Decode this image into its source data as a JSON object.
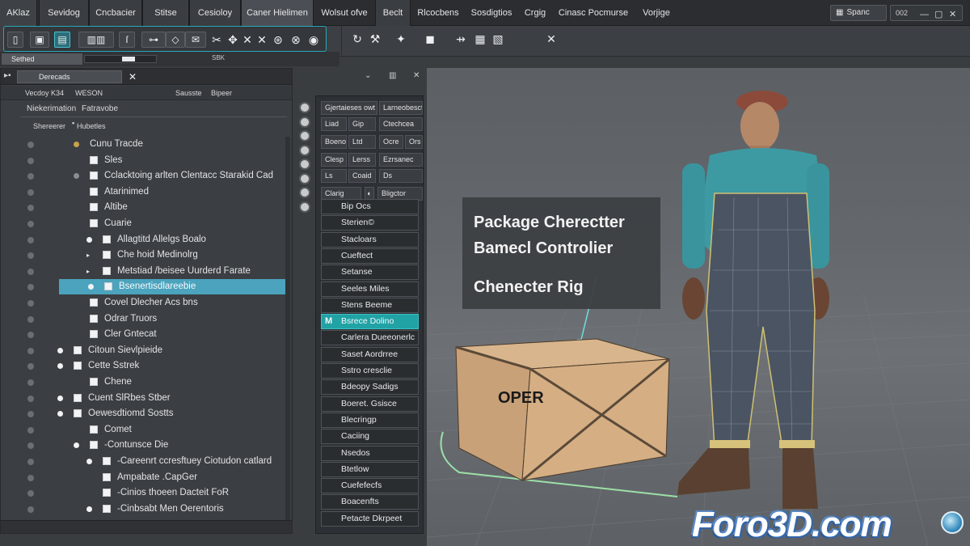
{
  "menubar": {
    "app_badge": "AKlaz",
    "items": [
      "Sevidog",
      "Cncbacier",
      "Stitse",
      "Cesioloy",
      "Caner Hielimen",
      "Wolsut ofve",
      "Beclt",
      "Rlcocbens",
      "Sosdigtios",
      "Crgig",
      "Cinasc Pocmurse",
      "Vorjige"
    ],
    "search_label": "Spanc",
    "system_label": "002"
  },
  "toolbar": {
    "group_icons": [
      "file-icon",
      "image-icon",
      "page-icon",
      "film-icon",
      "curve-icon",
      "node-icon",
      "mail-icon",
      "scissors-icon",
      "transform-icon",
      "close-icon",
      "globe-icon",
      "settings-icon"
    ],
    "right_icons": [
      "refresh-icon",
      "tool-icon",
      "pin-icon",
      "square-icon",
      "link-icon",
      "layout-icon",
      "close-icon"
    ]
  },
  "subbar": {
    "tab_label": "Sethed",
    "tag": "SBK"
  },
  "outliner": {
    "tab_label": "Derecads",
    "columns": {
      "left": "Vecdoy K34",
      "mid": "WESON",
      "right": "Sausste",
      "far": "Bipeer"
    },
    "filter_a": "Niekerimation",
    "filter_b": "Fatravobe",
    "filter2_a": "Shereerer",
    "filter2_b": "Hubetles",
    "rows": [
      {
        "label": "Cunu Tracde",
        "indent": 1,
        "marker": "gold"
      },
      {
        "label": "Sles",
        "indent": 2,
        "marker": "checkbox"
      },
      {
        "label": "Cclacktoing arlten Clentacc Starakid Cad",
        "indent": 2,
        "marker": "grey-checkbox"
      },
      {
        "label": "Atarinimed",
        "indent": 2,
        "marker": "checkbox"
      },
      {
        "label": "Altibe",
        "indent": 2,
        "marker": "checkbox"
      },
      {
        "label": "Cuarie",
        "indent": 2,
        "marker": "checkbox"
      },
      {
        "label": "Allagtitd Allelgs Boalo",
        "indent": 3,
        "marker": "dot-checkbox"
      },
      {
        "label": "Che hoid Medinolrg",
        "indent": 3,
        "marker": "arrow-checkbox"
      },
      {
        "label": "Metstiad /beisee Uurderd Farate",
        "indent": 3,
        "marker": "arrow-checkbox"
      },
      {
        "label": "Bsenertisdlareebie",
        "indent": 3,
        "marker": "dot-checkbox",
        "selected": true
      },
      {
        "label": "Covel Dlecher Acs bns",
        "indent": 2,
        "marker": "checkbox"
      },
      {
        "label": "Odrar Truors",
        "indent": 2,
        "marker": "checkbox"
      },
      {
        "label": "Cler Gntecat",
        "indent": 2,
        "marker": "checkbox"
      },
      {
        "label": "Citoun Sievlpieide",
        "indent": 1,
        "marker": "dot-checkbox"
      },
      {
        "label": "Cette Sstrek",
        "indent": 1,
        "marker": "dot-checkbox"
      },
      {
        "label": "Chene",
        "indent": 2,
        "marker": "checkbox"
      },
      {
        "label": "Cuent SlRbes Stber",
        "indent": 1,
        "marker": "dot-checkbox"
      },
      {
        "label": "Oewesdtiomd Sostts",
        "indent": 1,
        "marker": "dot-checkbox"
      },
      {
        "label": "Comet",
        "indent": 2,
        "marker": "checkbox"
      },
      {
        "label": "-Contunsce Die",
        "indent": 2,
        "marker": "dot-checkbox"
      },
      {
        "label": "-Careenrt ccresftuey Ciotudon catlard",
        "indent": 3,
        "marker": "dot-checkbox"
      },
      {
        "label": "Ampabate .CapGer",
        "indent": 3,
        "marker": "checkbox"
      },
      {
        "label": "-Cinios thoeen Dacteit FoR",
        "indent": 3,
        "marker": "checkbox"
      },
      {
        "label": "-Cinbsabt Men Oerentoris",
        "indent": 3,
        "marker": "dot-checkbox"
      }
    ]
  },
  "attributes": {
    "grid": [
      [
        "Gjertaieses owt",
        "Larneobesct"
      ],
      [
        "Liad",
        "Gip",
        "Ctechcea"
      ],
      [
        "Boeno",
        "Ltd",
        "Ocre",
        "Ors"
      ],
      [
        "Clesp",
        "Lerss",
        "Ezrsanec"
      ],
      [
        "Ls",
        "Coaid",
        "Ds"
      ],
      [
        "Clarig",
        "Bligctor"
      ]
    ],
    "items": [
      {
        "label": "Bip Ocs"
      },
      {
        "label": "Sterien©"
      },
      {
        "label": "Stacloars"
      },
      {
        "label": "Cueftect"
      },
      {
        "label": "Setanse"
      },
      {
        "label": "Seeles Miles"
      },
      {
        "label": "Stens Beeme"
      },
      {
        "label": "Bsrece Dolino",
        "selected": true,
        "prefix": "M"
      },
      {
        "label": "Carlera Dueeonerlc"
      },
      {
        "label": "Saset Aordrree"
      },
      {
        "label": "Sstro cresclie"
      },
      {
        "label": "Bdeopy Sadigs"
      },
      {
        "label": "Boeret.     Gsisce"
      },
      {
        "label": "Blecringp"
      },
      {
        "label": "Caciing"
      },
      {
        "label": "Nsedos"
      },
      {
        "label": "Btetlow"
      },
      {
        "label": "Cuefefecfs"
      },
      {
        "label": "Boacenfts"
      },
      {
        "label": "Petacte Dkrpeet"
      }
    ]
  },
  "viewport": {
    "label_line1": "Package Cherectter",
    "label_line2": "Bamecl Controlier",
    "label_line3": "Chenecter Rig",
    "box_text": "OPER",
    "brand": "Foro3D.com"
  }
}
